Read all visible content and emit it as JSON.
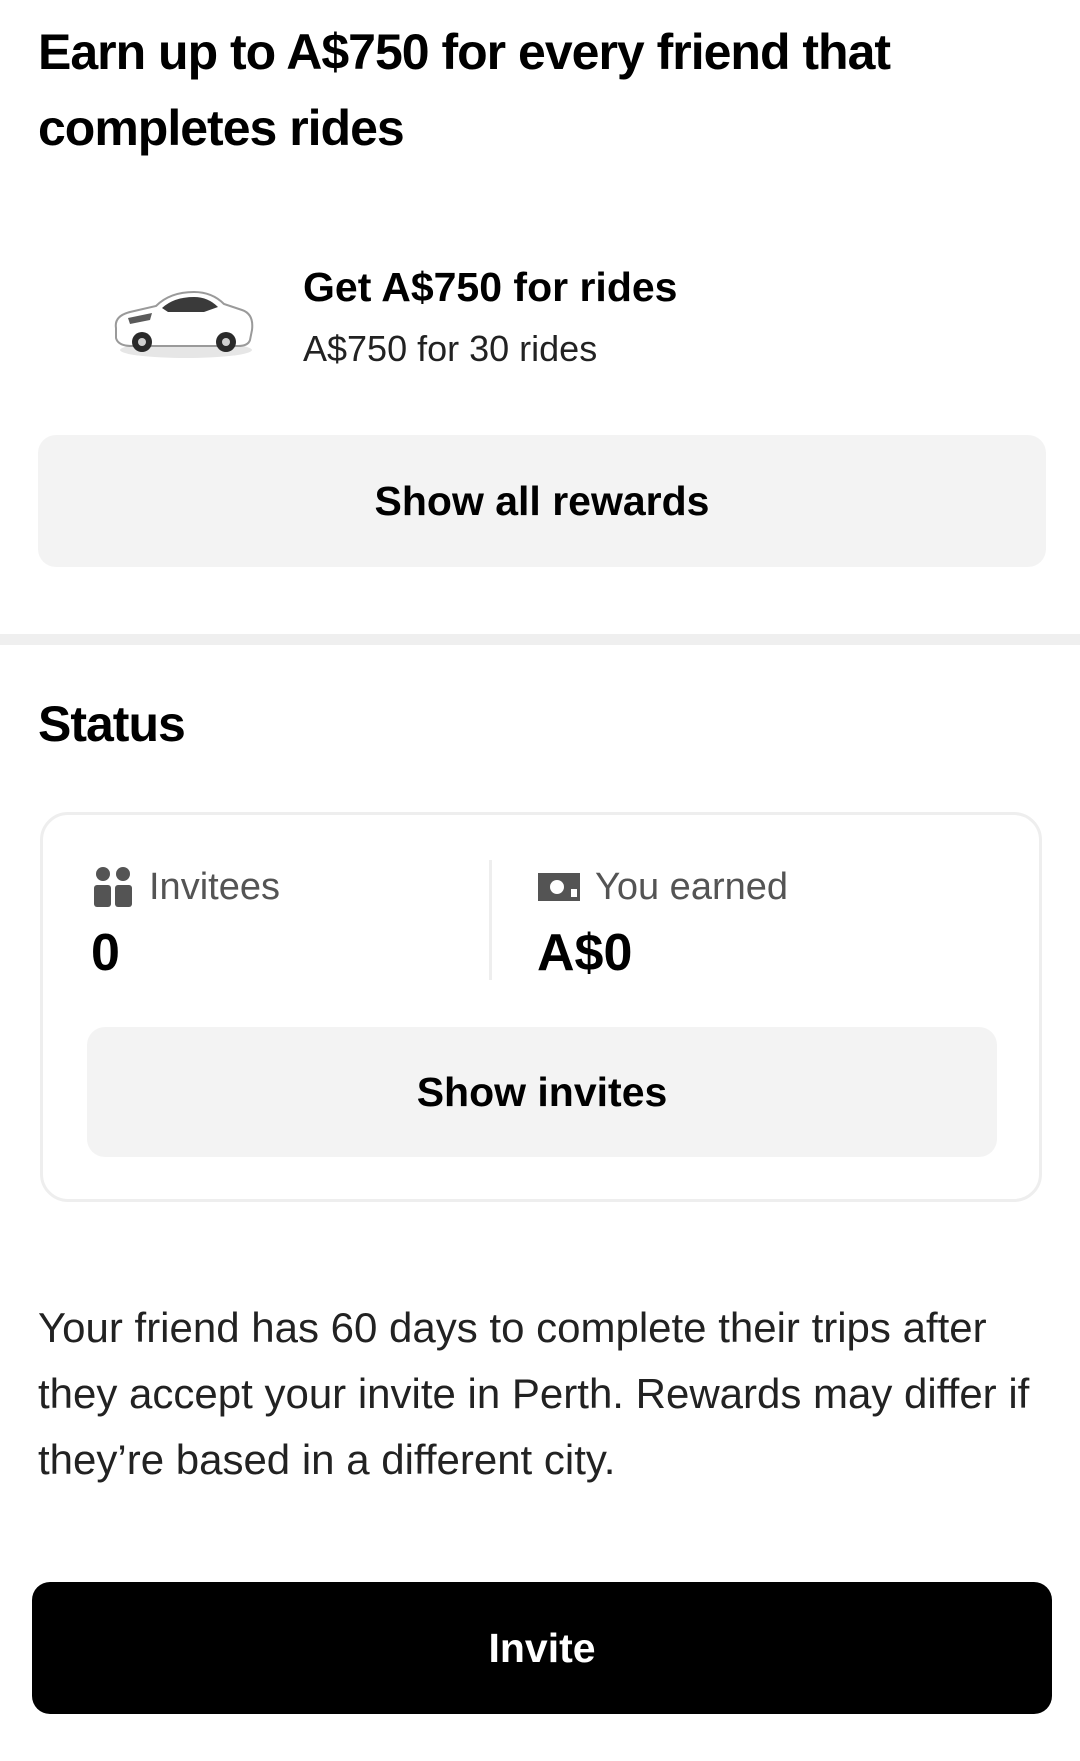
{
  "header": {
    "title": "Earn up to A$750 for every friend that completes rides"
  },
  "reward": {
    "icon": "car-icon",
    "title": "Get A$750 for rides",
    "subtitle": "A$750 for 30 rides"
  },
  "show_all_rewards_label": "Show all rewards",
  "status": {
    "title": "Status",
    "invitees": {
      "icon": "people-icon",
      "label": "Invitees",
      "value": "0"
    },
    "earned": {
      "icon": "cash-icon",
      "label": "You earned",
      "value": "A$0"
    },
    "show_invites_label": "Show invites"
  },
  "note": "Your friend has 60 days to complete their trips after they accept your invite in Perth. Rewards may differ if they’re based in a different city.",
  "invite_label": "Invite",
  "colors": {
    "primary": "#000000",
    "secondary_button_bg": "#f3f3f3",
    "muted_text": "#545454"
  }
}
